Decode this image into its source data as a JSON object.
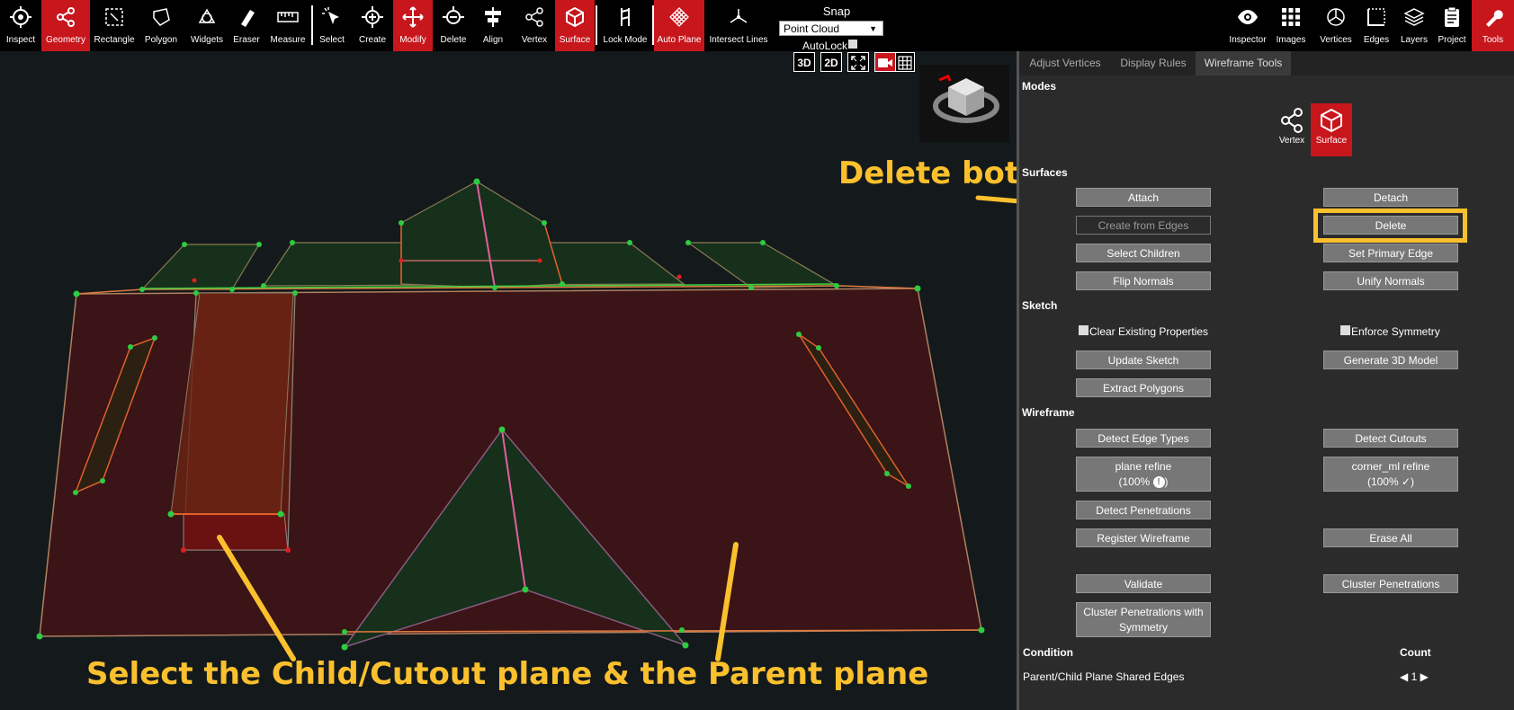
{
  "toolbar": {
    "left_tools": [
      {
        "label": "Inspect",
        "icon": "crosshair-icon",
        "active": false
      },
      {
        "label": "Geometry",
        "icon": "share-nodes-icon",
        "active": true
      },
      {
        "label": "Rectangle",
        "icon": "rectangle-select-icon",
        "active": false
      },
      {
        "label": "Polygon",
        "icon": "polygon-icon",
        "active": false
      },
      {
        "label": "Widgets",
        "icon": "shapes-icon",
        "active": false
      },
      {
        "label": "Eraser",
        "icon": "eraser-icon",
        "active": false
      },
      {
        "label": "Measure",
        "icon": "ruler-icon",
        "active": false
      },
      {
        "label": "Select",
        "icon": "cursor-click-icon",
        "active": false
      },
      {
        "label": "Create",
        "icon": "create-plus-icon",
        "active": false
      },
      {
        "label": "Modify",
        "icon": "move-arrows-icon",
        "active": true
      },
      {
        "label": "Delete",
        "icon": "delete-minus-icon",
        "active": false
      },
      {
        "label": "Align",
        "icon": "align-icon",
        "active": false
      },
      {
        "label": "Vertex",
        "icon": "vertex-share-icon",
        "active": false
      },
      {
        "label": "Surface",
        "icon": "cube-icon",
        "active": true
      },
      {
        "label": "Lock Mode",
        "icon": "lock-mode-icon",
        "active": false
      },
      {
        "label": "Auto Plane",
        "icon": "grid-plane-icon",
        "active": true
      },
      {
        "label": "Intersect Lines",
        "icon": "intersect-lines-icon",
        "active": false
      }
    ],
    "snap_title": "Snap",
    "snap_value": "Point Cloud",
    "autolock_label": "AutoLock",
    "right_tools": [
      {
        "label": "Inspector",
        "icon": "eye-icon",
        "active": false
      },
      {
        "label": "Images",
        "icon": "grid-dots-icon",
        "active": false
      },
      {
        "label": "Vertices",
        "icon": "vertices-icon",
        "active": false
      },
      {
        "label": "Edges",
        "icon": "edges-icon",
        "active": false
      },
      {
        "label": "Layers",
        "icon": "layers-icon",
        "active": false
      },
      {
        "label": "Project",
        "icon": "clipboard-icon",
        "active": false
      },
      {
        "label": "Tools",
        "icon": "wrench-icon",
        "active": true
      }
    ]
  },
  "view_controls": {
    "btn_3d": "3D",
    "btn_2d": "2D"
  },
  "panel": {
    "tabs": [
      "Adjust Vertices",
      "Display Rules",
      "Wireframe Tools"
    ],
    "modes_title": "Modes",
    "mode_vertex": "Vertex",
    "mode_surface": "Surface",
    "surfaces_title": "Surfaces",
    "attach": "Attach",
    "detach": "Detach",
    "create_from_edges": "Create from Edges",
    "delete": "Delete",
    "select_children": "Select Children",
    "set_primary_edge": "Set Primary Edge",
    "flip_normals": "Flip Normals",
    "unify_normals": "Unify Normals",
    "sketch_title": "Sketch",
    "clear_existing": "Clear Existing Properties",
    "enforce_symmetry": "Enforce Symmetry",
    "update_sketch": "Update Sketch",
    "generate_3d": "Generate 3D Model",
    "extract_polygons": "Extract Polygons",
    "wireframe_title": "Wireframe",
    "detect_edge_types": "Detect Edge Types",
    "detect_cutouts": "Detect Cutouts",
    "plane_refine": "plane refine",
    "plane_refine_pct": "(100%",
    "plane_refine_close": ")",
    "corner_refine": "corner_ml refine",
    "corner_refine_pct": "(100%",
    "corner_refine_close": ")",
    "detect_penetrations": "Detect Penetrations",
    "register_wireframe": "Register Wireframe",
    "erase_all": "Erase All",
    "validate": "Validate",
    "cluster_penetrations": "Cluster Penetrations",
    "cluster_sym_1": "Cluster Penetrations with",
    "cluster_sym_2": "Symmetry",
    "condition_header": "Condition",
    "count_header": "Count",
    "condition_row": "Parent/Child Plane Shared Edges",
    "count_value": "1"
  },
  "annotations": {
    "delete_both": "Delete both",
    "select_planes": "Select the Child/Cutout plane & the Parent plane",
    "color": "#fbc02d"
  },
  "colors": {
    "accent": "#c8161d",
    "panel": "#2b2b2b",
    "parent_plane": "#3a1416",
    "child_plane": "#5a1a12",
    "green_plane": "#16301c"
  }
}
